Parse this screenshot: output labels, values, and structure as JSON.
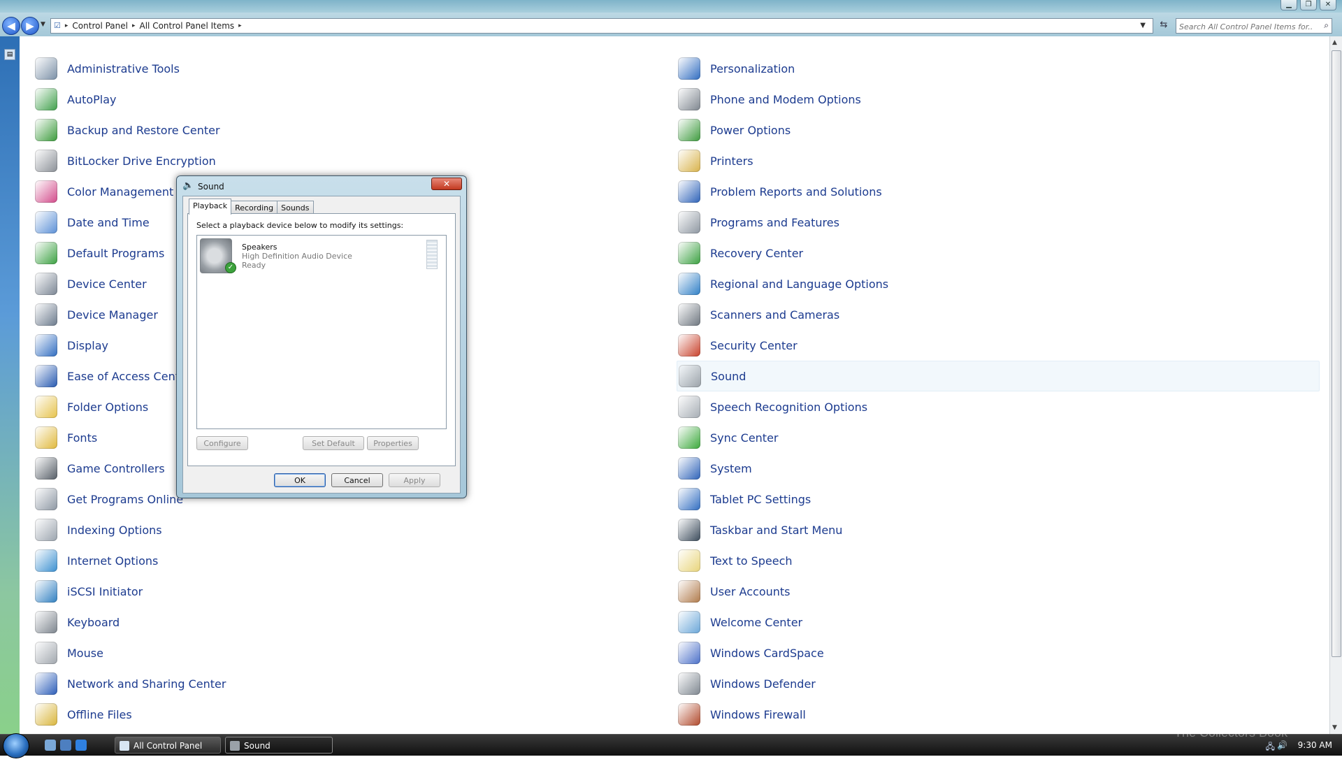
{
  "window": {
    "address_parts": [
      "Control Panel",
      "All Control Panel Items"
    ],
    "search_placeholder": "Search All Control Panel Items for..."
  },
  "items_left": [
    {
      "label": "Administrative Tools",
      "icon": "admin-tools-icon",
      "color": "#7a8fa6"
    },
    {
      "label": "AutoPlay",
      "icon": "autoplay-icon",
      "color": "#3f9f4a"
    },
    {
      "label": "Backup and Restore Center",
      "icon": "backup-icon",
      "color": "#3a9a3a"
    },
    {
      "label": "BitLocker Drive Encryption",
      "icon": "bitlocker-icon",
      "color": "#8a8f96"
    },
    {
      "label": "Color Management",
      "icon": "color-management-icon",
      "color": "#d24a8a"
    },
    {
      "label": "Date and Time",
      "icon": "date-time-icon",
      "color": "#5a8fd6"
    },
    {
      "label": "Default Programs",
      "icon": "default-programs-icon",
      "color": "#3aa040"
    },
    {
      "label": "Device Center",
      "icon": "device-center-icon",
      "color": "#7b8694"
    },
    {
      "label": "Device Manager",
      "icon": "device-manager-icon",
      "color": "#6b7a8c"
    },
    {
      "label": "Display",
      "icon": "display-icon",
      "color": "#2f6cc0"
    },
    {
      "label": "Ease of Access Center",
      "icon": "ease-of-access-icon",
      "color": "#2558b0"
    },
    {
      "label": "Folder Options",
      "icon": "folder-options-icon",
      "color": "#e6c24a"
    },
    {
      "label": "Fonts",
      "icon": "fonts-icon",
      "color": "#e0b83a"
    },
    {
      "label": "Game Controllers",
      "icon": "game-controllers-icon",
      "color": "#555d66"
    },
    {
      "label": "Get Programs Online",
      "icon": "get-programs-icon",
      "color": "#8c96a2"
    },
    {
      "label": "Indexing Options",
      "icon": "indexing-options-icon",
      "color": "#9aa3ad"
    },
    {
      "label": "Internet Options",
      "icon": "internet-options-icon",
      "color": "#3a8fd0"
    },
    {
      "label": "iSCSI Initiator",
      "icon": "iscsi-icon",
      "color": "#2f7fc0"
    },
    {
      "label": "Keyboard",
      "icon": "keyboard-icon",
      "color": "#7c848d"
    },
    {
      "label": "Mouse",
      "icon": "mouse-icon",
      "color": "#a0a6ad"
    },
    {
      "label": "Network and Sharing Center",
      "icon": "network-icon",
      "color": "#2a5cb8"
    },
    {
      "label": "Offline Files",
      "icon": "offline-files-icon",
      "color": "#d9b53a"
    }
  ],
  "items_right": [
    {
      "label": "Personalization",
      "icon": "personalization-icon",
      "color": "#2f6cc0"
    },
    {
      "label": "Phone and Modem Options",
      "icon": "phone-modem-icon",
      "color": "#7d858e"
    },
    {
      "label": "Power Options",
      "icon": "power-options-icon",
      "color": "#3d9a3d"
    },
    {
      "label": "Printers",
      "icon": "printers-icon",
      "color": "#d8b24a"
    },
    {
      "label": "Problem Reports and Solutions",
      "icon": "problem-reports-icon",
      "color": "#2d62b8"
    },
    {
      "label": "Programs and Features",
      "icon": "programs-features-icon",
      "color": "#8d96a0"
    },
    {
      "label": "Recovery Center",
      "icon": "recovery-icon",
      "color": "#3aa040"
    },
    {
      "label": "Regional and Language Options",
      "icon": "regional-icon",
      "color": "#2f7fc6"
    },
    {
      "label": "Scanners and Cameras",
      "icon": "scanners-icon",
      "color": "#6e767f"
    },
    {
      "label": "Security Center",
      "icon": "security-center-icon",
      "color": "#c8402a"
    },
    {
      "label": "Sound",
      "icon": "sound-icon",
      "color": "#9aa1a8"
    },
    {
      "label": "Speech Recognition Options",
      "icon": "speech-recognition-icon",
      "color": "#a5acb3"
    },
    {
      "label": "Sync Center",
      "icon": "sync-center-icon",
      "color": "#3aa83a"
    },
    {
      "label": "System",
      "icon": "system-icon",
      "color": "#2d62b8"
    },
    {
      "label": "Tablet PC Settings",
      "icon": "tablet-pc-icon",
      "color": "#2f6cc0"
    },
    {
      "label": "Taskbar and Start Menu",
      "icon": "taskbar-start-icon",
      "color": "#3a4a5a"
    },
    {
      "label": "Text to Speech",
      "icon": "text-to-speech-icon",
      "color": "#e8d47a"
    },
    {
      "label": "User Accounts",
      "icon": "user-accounts-icon",
      "color": "#b07a4a"
    },
    {
      "label": "Welcome Center",
      "icon": "welcome-center-icon",
      "color": "#6aa6d8"
    },
    {
      "label": "Windows CardSpace",
      "icon": "cardspace-icon",
      "color": "#4a6fc8"
    },
    {
      "label": "Windows Defender",
      "icon": "defender-icon",
      "color": "#7e868f"
    },
    {
      "label": "Windows Firewall",
      "icon": "firewall-icon",
      "color": "#b0482a"
    }
  ],
  "selected_item": "Sound",
  "dialog": {
    "title": "Sound",
    "tabs": [
      "Playback",
      "Recording",
      "Sounds"
    ],
    "active_tab": "Playback",
    "instruction": "Select a playback device below to modify its settings:",
    "device": {
      "name": "Speakers",
      "description": "High Definition Audio Device",
      "status": "Ready"
    },
    "buttons": {
      "configure": "Configure",
      "set_default": "Set Default",
      "properties": "Properties",
      "ok": "OK",
      "cancel": "Cancel",
      "apply": "Apply"
    }
  },
  "taskbar": {
    "tasks": [
      {
        "label": "All Control Panel Ite..."
      },
      {
        "label": "Sound"
      }
    ],
    "clock": "9:30 AM"
  },
  "watermark": "The Collectors Book"
}
